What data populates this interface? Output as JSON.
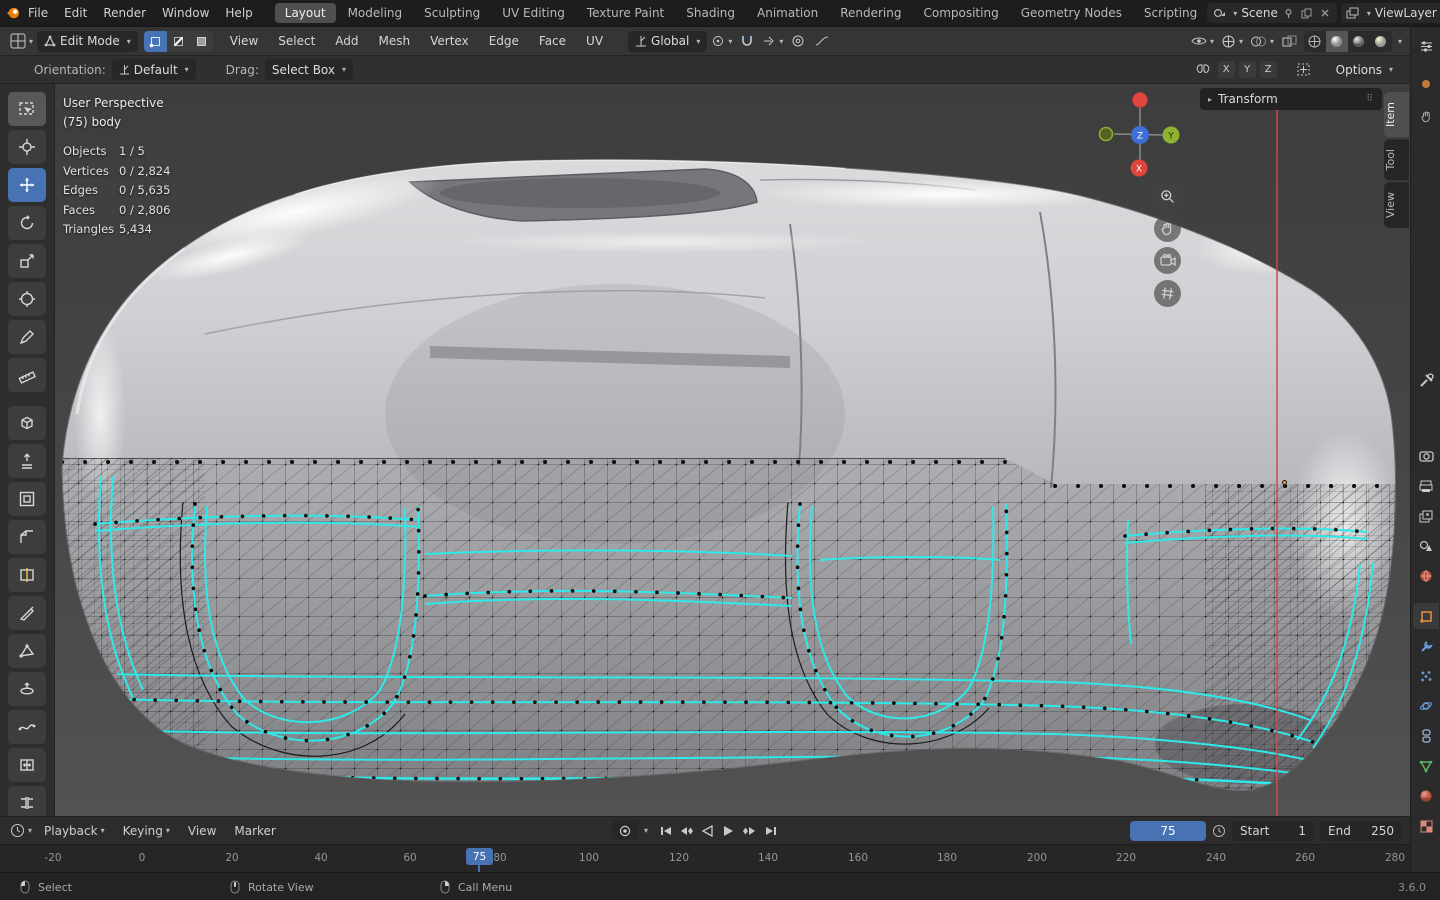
{
  "topbar": {
    "app_menus": [
      "File",
      "Edit",
      "Render",
      "Window",
      "Help"
    ],
    "workspaces": [
      "Layout",
      "Modeling",
      "Sculpting",
      "UV Editing",
      "Texture Paint",
      "Shading",
      "Animation",
      "Rendering",
      "Compositing",
      "Geometry Nodes",
      "Scripting"
    ],
    "active_workspace": "Layout",
    "scene_label": "Scene",
    "viewlayer_label": "ViewLayer"
  },
  "viewport_header": {
    "mode": "Edit Mode",
    "menus": [
      "View",
      "Select",
      "Add",
      "Mesh",
      "Vertex",
      "Edge",
      "Face",
      "UV"
    ],
    "orientation": "Global"
  },
  "tool_settings": {
    "orientation_label": "Orientation:",
    "orientation_value": "Default",
    "drag_label": "Drag:",
    "drag_value": "Select Box",
    "axis_toggles": [
      "X",
      "Y",
      "Z"
    ],
    "options_label": "Options"
  },
  "toolbar_tools": [
    "select-box",
    "cursor",
    "move",
    "rotate",
    "scale",
    "transform",
    "annotate",
    "measure",
    "add-cube",
    "extrude-region",
    "inset-faces",
    "bevel",
    "loop-cut",
    "knife",
    "poly-build",
    "spin",
    "smooth",
    "edge-slide",
    "rip-region"
  ],
  "viewport": {
    "view_label": "User Perspective",
    "object_label": "(75) body",
    "stats": [
      {
        "name": "Objects",
        "value": "1 / 5"
      },
      {
        "name": "Vertices",
        "value": "0 / 2,824"
      },
      {
        "name": "Edges",
        "value": "0 / 5,635"
      },
      {
        "name": "Faces",
        "value": "0 / 2,806"
      },
      {
        "name": "Triangles",
        "value": "5,434"
      }
    ],
    "gizmo": {
      "z": "Z",
      "y": "Y",
      "x": "X"
    },
    "npanel": {
      "title": "Transform",
      "tabs": [
        "Item",
        "Tool",
        "View"
      ],
      "active_tab": "Item"
    }
  },
  "properties_tabs": [
    "active-tool",
    "render",
    "output",
    "view-layer",
    "scene",
    "world",
    "object",
    "modifiers",
    "particles",
    "physics",
    "constraints",
    "object-data",
    "material",
    "texture"
  ],
  "timeline": {
    "menus": [
      "Playback",
      "Keying",
      "View",
      "Marker"
    ],
    "current_frame": "75",
    "start_label": "Start",
    "start_value": "1",
    "end_label": "End",
    "end_value": "250",
    "ruler": [
      "-20",
      "0",
      "20",
      "40",
      "60",
      "80",
      "100",
      "120",
      "140",
      "160",
      "180",
      "200",
      "220",
      "240",
      "260",
      "280"
    ]
  },
  "statusbar": {
    "select_label": "Select",
    "rotate_label": "Rotate View",
    "menu_label": "Call Menu",
    "version": "3.6.0"
  },
  "colors": {
    "accent": "#4772b3",
    "selection": "#2fe8e8",
    "active_vertex": "#ff9a1f"
  }
}
